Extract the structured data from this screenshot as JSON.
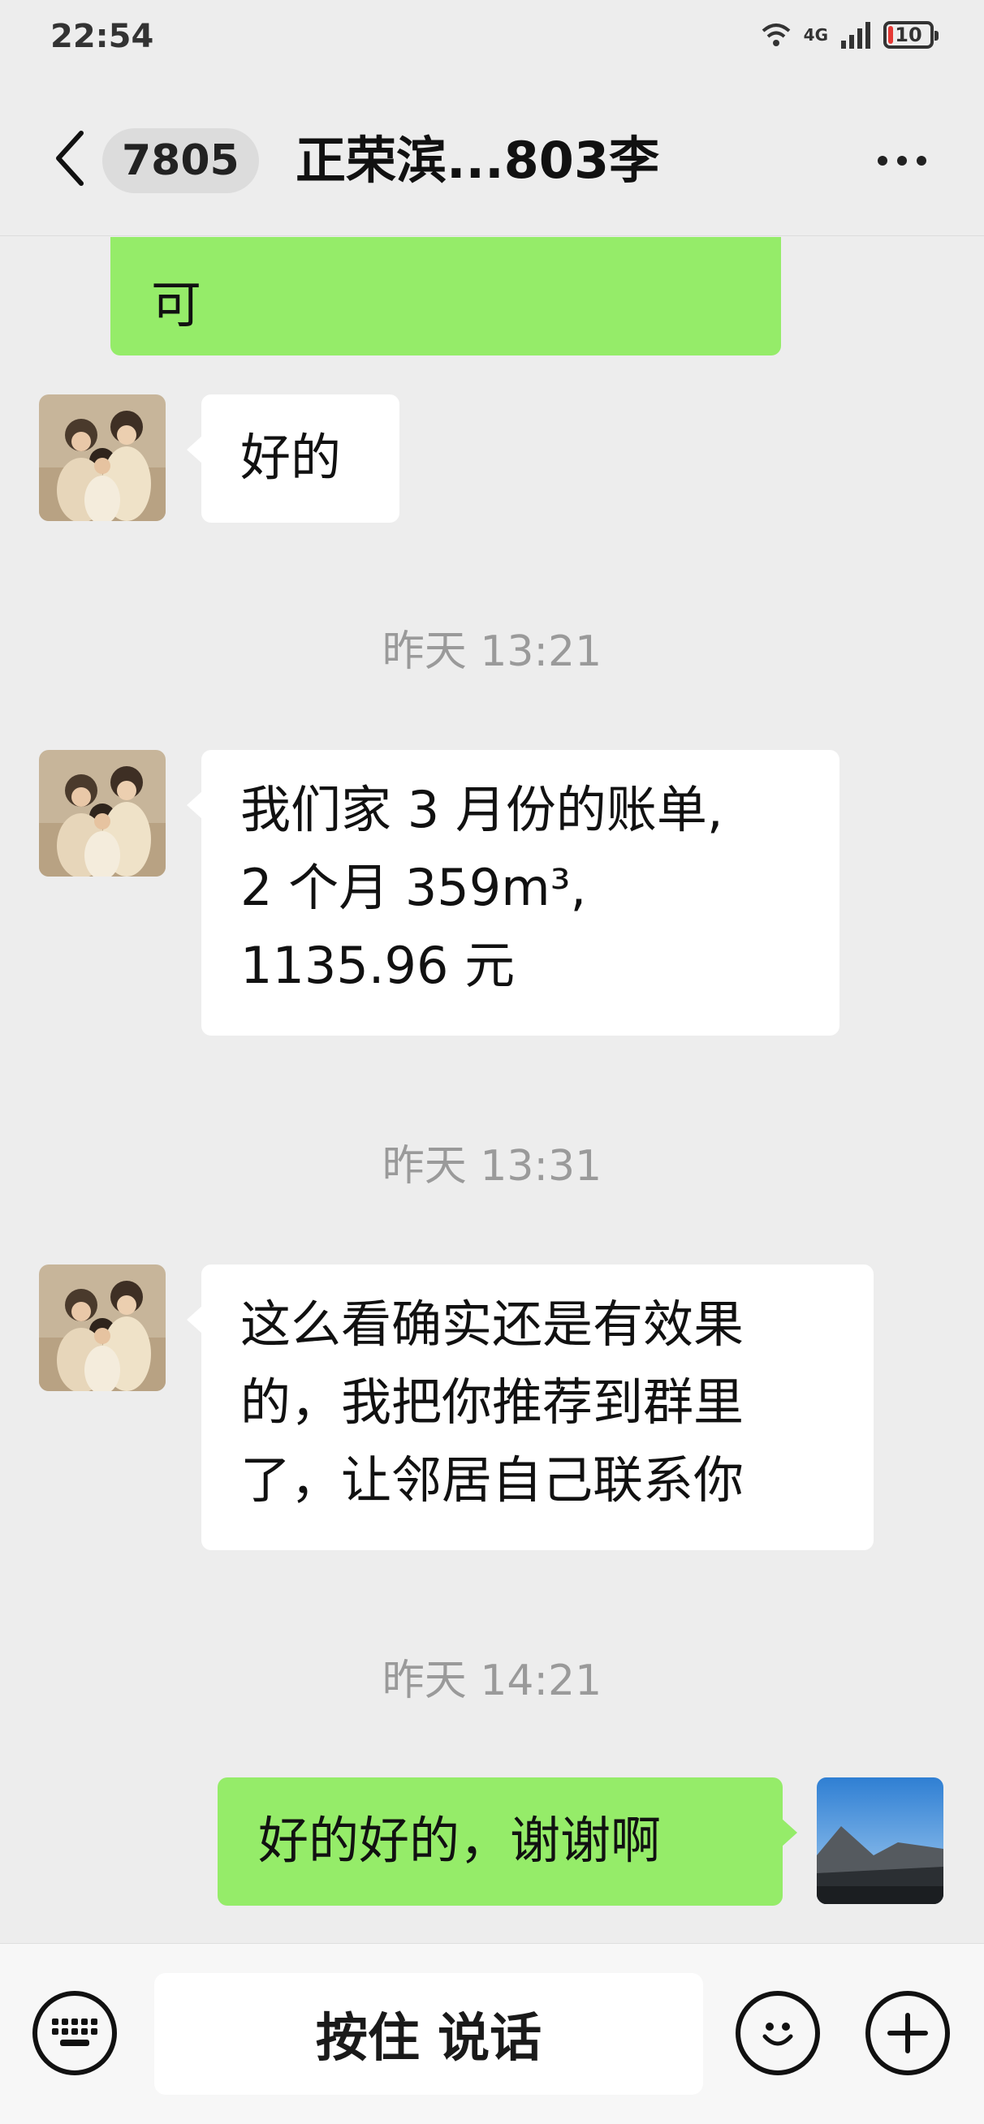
{
  "status_bar": {
    "time": "22:54",
    "network": "4G",
    "battery": "10"
  },
  "header": {
    "unread_count": "7805",
    "title": "正荣滨...803李"
  },
  "messages": [
    {
      "type": "out",
      "text": "可"
    },
    {
      "type": "in",
      "text": "好的"
    },
    {
      "type": "time",
      "text": "昨天 13:21"
    },
    {
      "type": "in",
      "lines": [
        "我们家 3 月份的账单,",
        "2 个月 359m³,",
        "1135.96 元"
      ]
    },
    {
      "type": "time",
      "text": "昨天 13:31"
    },
    {
      "type": "in",
      "lines": [
        "这么看确实还是有效果",
        "的，我把你推荐到群里",
        "了，让邻居自己联系你"
      ]
    },
    {
      "type": "time",
      "text": "昨天 14:21"
    },
    {
      "type": "out",
      "text": "好的好的，谢谢啊"
    }
  ],
  "input_bar": {
    "hold_to_talk": "按住 说话"
  },
  "icons": {
    "back": "chevron-left-icon",
    "more": "more-dots-icon",
    "keyboard": "keyboard-icon",
    "emoji": "emoji-icon",
    "plus": "plus-icon"
  },
  "colors": {
    "out_bubble": "#95ec69",
    "in_bubble": "#ffffff",
    "background": "#ededed"
  }
}
